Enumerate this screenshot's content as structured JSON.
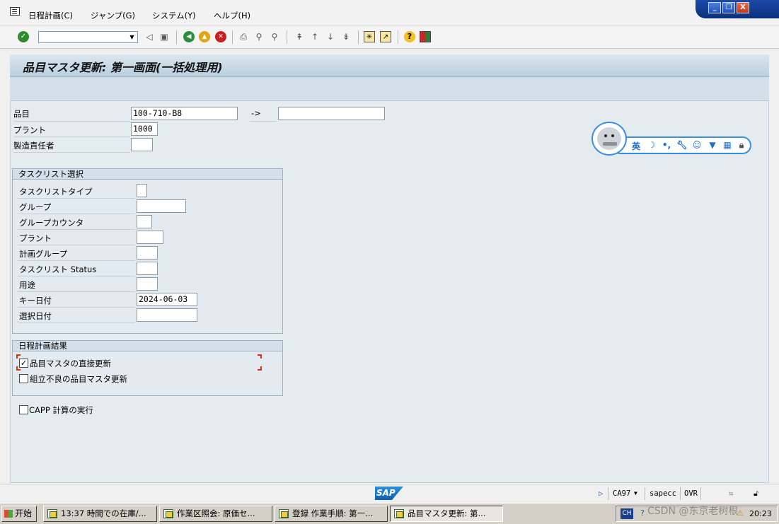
{
  "menu": {
    "items": [
      "日程計画(C)",
      "ジャンプ(G)",
      "システム(Y)",
      "ヘルプ(H)"
    ]
  },
  "window_controls": {
    "minimize": "_",
    "restore": "❐",
    "close": "X"
  },
  "toolbar": {
    "command_field_value": "",
    "icons": [
      "enter-icon",
      "back-icon",
      "exit-icon",
      "cancel-icon",
      "print-icon",
      "find-icon",
      "find-next-icon",
      "first-page-icon",
      "prev-page-icon",
      "next-page-icon",
      "last-page-icon",
      "create-session-icon",
      "shortcut-icon",
      "help-icon",
      "layout-icon"
    ]
  },
  "title": "品目マスタ更新: 第一画面(一括処理用)",
  "header_fields": {
    "material_label": "品目",
    "material_from": "100-710-B8",
    "range_arrow": "->",
    "material_to": "",
    "plant_label": "プラント",
    "plant_value": "1000",
    "mrp_controller_label": "製造責任者",
    "mrp_controller_value": ""
  },
  "task_list_group": {
    "title": "タスクリスト選択",
    "fields": [
      {
        "label": "タスクリストタイプ",
        "value": ""
      },
      {
        "label": "グループ",
        "value": ""
      },
      {
        "label": "グループカウンタ",
        "value": ""
      },
      {
        "label": "プラント",
        "value": ""
      },
      {
        "label": "計画グループ",
        "value": ""
      },
      {
        "label": "タスクリスト Status",
        "value": ""
      },
      {
        "label": "用途",
        "value": ""
      },
      {
        "label": "キー日付",
        "value": "2024-06-03"
      },
      {
        "label": "選択日付",
        "value": ""
      }
    ]
  },
  "result_group": {
    "title": "日程計画結果",
    "options": [
      {
        "label": "品目マスタの直接更新",
        "checked": true
      },
      {
        "label": "組立不良の品目マスタ更新",
        "checked": false
      }
    ]
  },
  "capp_option": {
    "label": "CAPP 計算の実行",
    "checked": false
  },
  "ime": {
    "mode": "英",
    "icons": [
      "moon-icon",
      "punctuation-icon",
      "wrench-icon",
      "smiley-icon",
      "shirt-icon",
      "grid-icon",
      "lock-icon"
    ]
  },
  "statusbar": {
    "logo": "SAP",
    "transaction": "CA97",
    "server": "sapecc",
    "mode": "OVR"
  },
  "taskbar": {
    "start": "开始",
    "tasks": [
      "13:37 時間での在庫/...",
      "作業区照会: 原価セ...",
      "登録 作業手順: 第一...",
      "品目マスタ更新: 第..."
    ],
    "tray": {
      "lang": "CH",
      "time": "20:23"
    }
  },
  "watermark": "CSDN @东京老树根"
}
